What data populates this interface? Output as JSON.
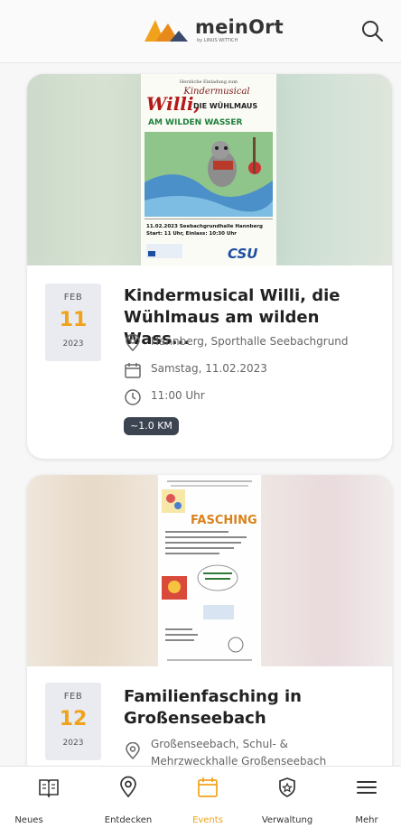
{
  "header": {
    "logo_text": "meinOrt",
    "logo_sub": "by LINUS WITTICH"
  },
  "events": [
    {
      "month": "FEB",
      "day": "11",
      "year": "2023",
      "title_line1": "Kindermusical Willi, die",
      "title_line2": "Wühlmaus am wilden Wass...",
      "location": "Hannberg, Sporthalle Seebachgrund",
      "date": "Samstag, 11.02.2023",
      "time": "11:00 Uhr",
      "distance": "~1.0 KM",
      "poster": {
        "invite": "Herzliche Einladung zum",
        "headline": "Kindermusical",
        "title_a": "Willi,",
        "title_b": "DIE WÜHLMAUS",
        "title_c": "AM WILDEN WASSER",
        "footer_1": "11.02.2023 Seebachgrundhalle Hannberg",
        "footer_2": "Start: 11 Uhr, Einlass: 10:30 Uhr",
        "sponsor": "CSU"
      }
    },
    {
      "month": "FEB",
      "day": "12",
      "year": "2023",
      "title_line1": "Familienfasching in",
      "title_line2": "Großenseebach",
      "location": "Großenseebach, Schul- & Mehrzweckhalle Großenseebach",
      "poster": {
        "headline": "FASCHING"
      }
    }
  ],
  "tabs": [
    {
      "label": "Neues",
      "icon": "book-icon"
    },
    {
      "label": "Entdecken",
      "icon": "map-pin-icon"
    },
    {
      "label": "Events",
      "icon": "calendar-icon",
      "active": true
    },
    {
      "label": "Verwaltung",
      "icon": "shield-icon"
    },
    {
      "label": "Mehr",
      "icon": "menu-icon"
    }
  ],
  "colors": {
    "accent": "#f0a31a",
    "badge": "#3b4450",
    "date_box": "#e9ebf1"
  }
}
